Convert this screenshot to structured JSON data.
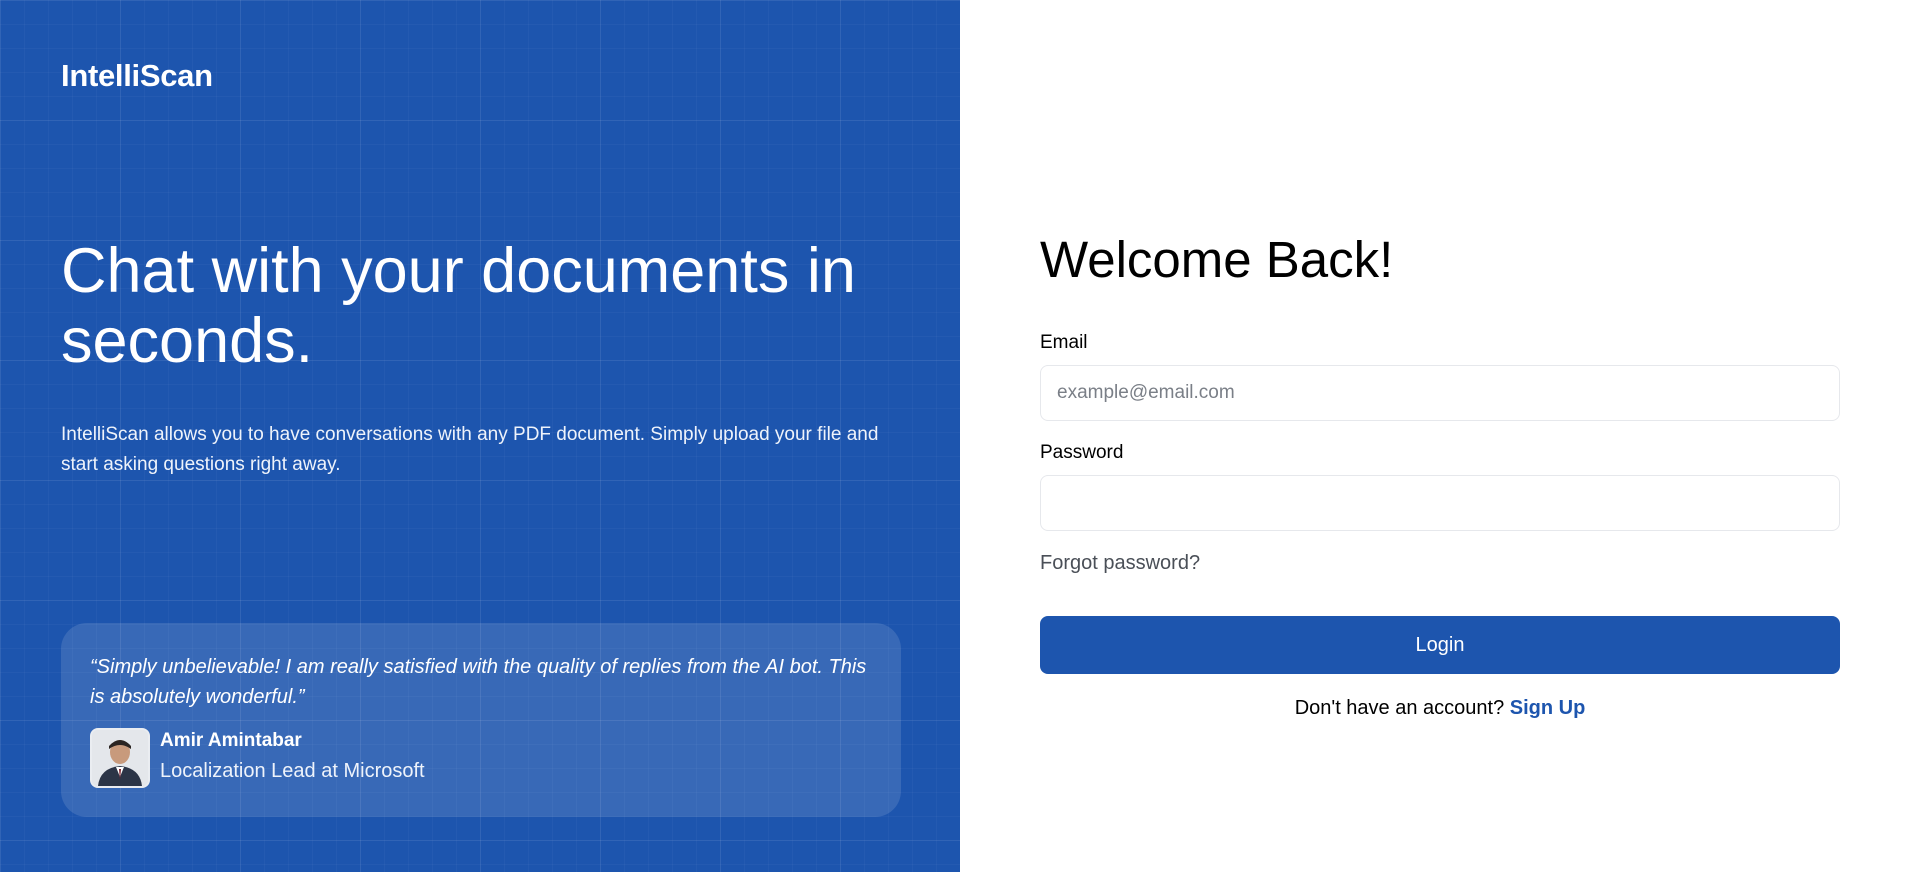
{
  "brand": {
    "name": "IntelliScan"
  },
  "hero": {
    "title": "Chat with your documents in seconds.",
    "description": "IntelliScan allows you to have conversations with any PDF document. Simply upload your file and start asking questions right away."
  },
  "testimonial": {
    "quote": "“Simply unbelievable! I am really satisfied with the quality of replies from the AI bot. This is absolutely wonderful.”",
    "author_name": "Amir Amintabar",
    "author_role": "Localization Lead at Microsoft"
  },
  "login": {
    "title": "Welcome Back!",
    "email_label": "Email",
    "email_placeholder": "example@email.com",
    "email_value": "",
    "password_label": "Password",
    "password_value": "",
    "forgot_label": "Forgot password?",
    "login_label": "Login",
    "signup_prompt": "Don't have an account?",
    "signup_label": "Sign Up"
  },
  "colors": {
    "brand_blue": "#1d55ae",
    "white": "#ffffff"
  }
}
